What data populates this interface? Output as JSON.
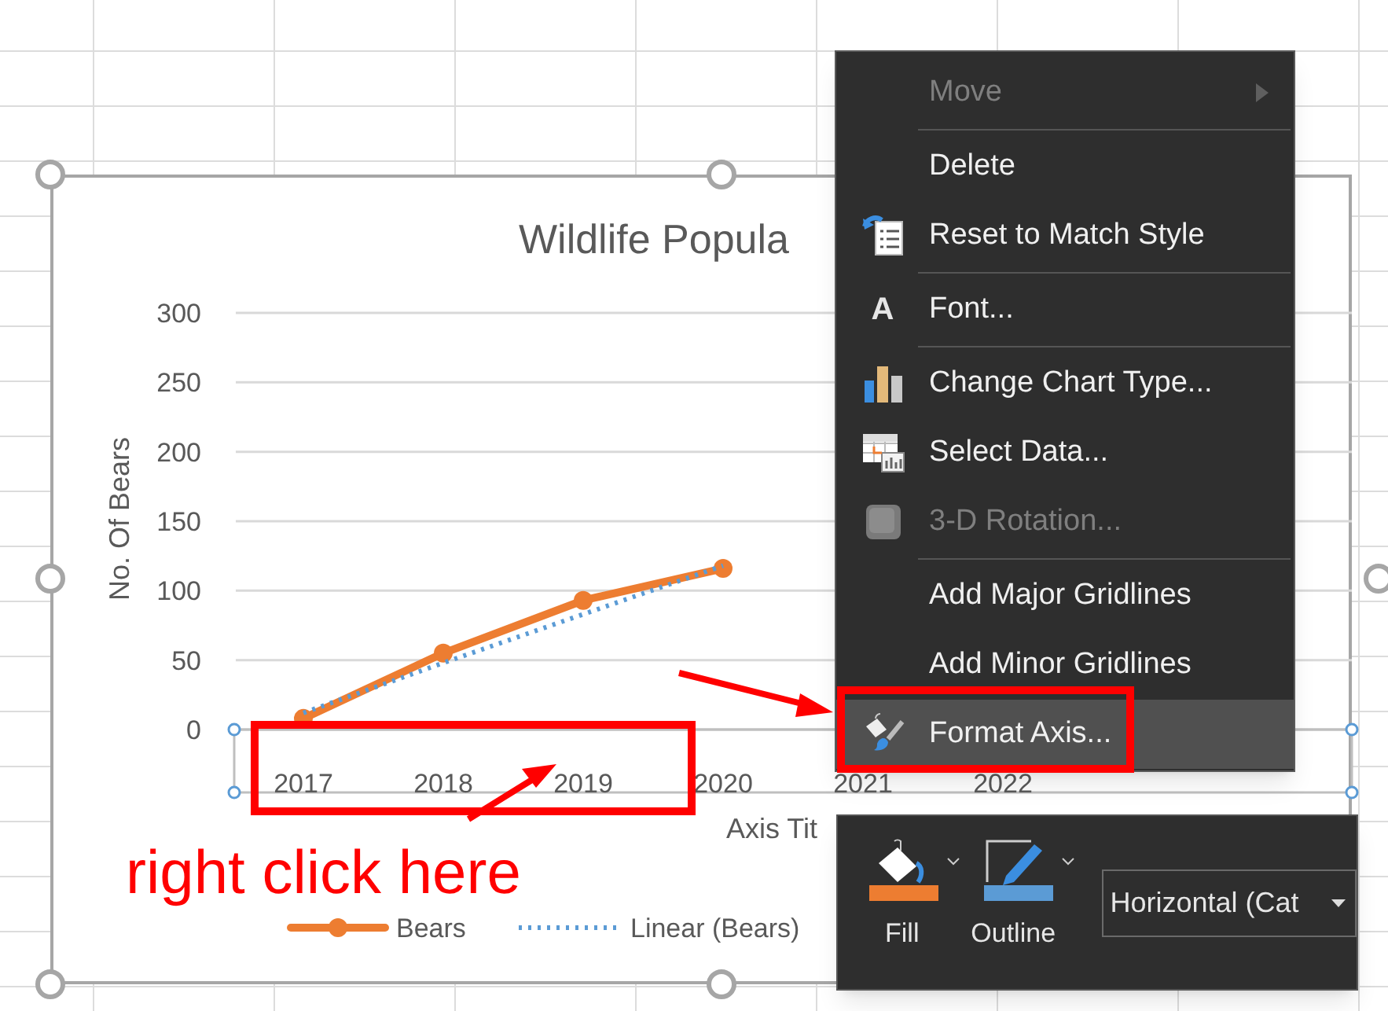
{
  "chart": {
    "title": "Wildlife Popula",
    "y_axis_title": "No. Of Bears",
    "x_axis_title": "Axis Tit",
    "chart_data": {
      "type": "line",
      "categories": [
        "2017",
        "2018",
        "2019",
        "2020",
        "2021",
        "2022"
      ],
      "ylim": [
        0,
        300
      ],
      "yticks": [
        0,
        50,
        100,
        150,
        200,
        250,
        300
      ],
      "grid": true,
      "legend": "bottom",
      "series": [
        {
          "name": "Bears",
          "color": "#ed7d31",
          "marker": "circle",
          "line_style": "solid",
          "values": [
            8,
            55,
            93,
            116,
            null,
            null
          ]
        },
        {
          "name": "Linear (Bears)",
          "color": "#5b9bd5",
          "marker": "none",
          "line_style": "dotted",
          "values": [
            12,
            48,
            83,
            118,
            null,
            null
          ]
        }
      ]
    }
  },
  "annotation": {
    "text": "right click here"
  },
  "context_menu": {
    "items": [
      {
        "label": "Move",
        "disabled": true,
        "submenu": true,
        "selected": false,
        "separator_after": true
      },
      {
        "label": "Delete",
        "disabled": false,
        "submenu": false,
        "selected": false,
        "separator_after": false
      },
      {
        "label": "Reset to Match Style",
        "disabled": false,
        "submenu": false,
        "selected": false,
        "separator_after": true
      },
      {
        "label": "Font...",
        "icon_text": "A",
        "disabled": false,
        "submenu": false,
        "selected": false,
        "separator_after": true
      },
      {
        "label": "Change Chart Type...",
        "disabled": false,
        "submenu": false,
        "selected": false,
        "separator_after": false
      },
      {
        "label": "Select Data...",
        "disabled": false,
        "submenu": false,
        "selected": false,
        "separator_after": false
      },
      {
        "label": "3-D Rotation...",
        "disabled": true,
        "submenu": false,
        "selected": false,
        "separator_after": true
      },
      {
        "label": "Add Major Gridlines",
        "disabled": false,
        "submenu": false,
        "selected": false,
        "separator_after": false
      },
      {
        "label": "Add Minor Gridlines",
        "disabled": false,
        "submenu": false,
        "selected": false,
        "separator_after": false
      },
      {
        "label": "Format Axis...",
        "disabled": false,
        "submenu": false,
        "selected": true,
        "separator_after": false
      }
    ]
  },
  "mini_toolbar": {
    "fill": {
      "label": "Fill",
      "color": "#ed7d31"
    },
    "outline": {
      "label": "Outline",
      "color": "#5b9bd5"
    },
    "element_select": {
      "value": "Horizontal (Cat"
    }
  }
}
